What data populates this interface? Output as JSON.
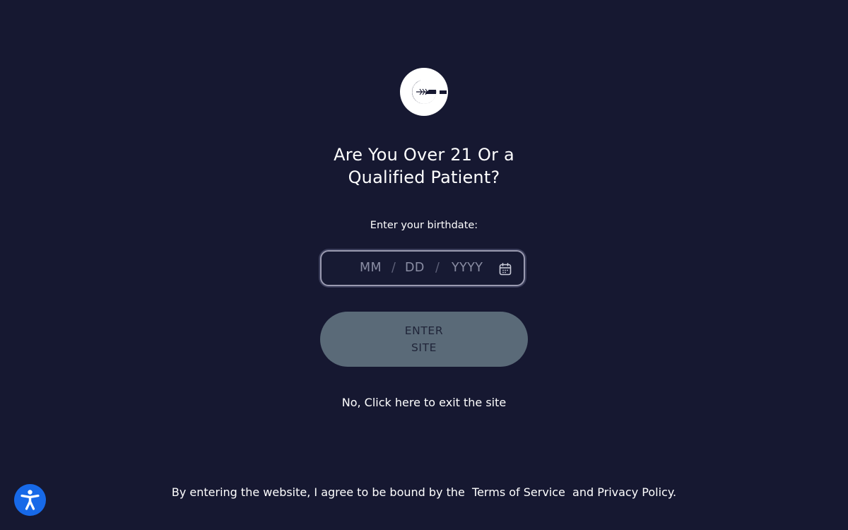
{
  "gate": {
    "title_line1": "Are You Over 21 Or a",
    "title_line2": "Qualified Patient?",
    "prompt": "Enter your birthdate:",
    "date": {
      "month_placeholder": "MM",
      "day_placeholder": "DD",
      "year_placeholder": "YYYY",
      "separator": "/"
    },
    "enter_line1": "ENTER",
    "enter_line2": "SITE",
    "exit_link": "No, Click here to exit the site"
  },
  "footer": {
    "prefix": "By entering the website, I agree to be bound by the",
    "terms_link": "Terms of Service",
    "joiner": "and",
    "privacy_link": "Privacy Policy",
    "suffix": "."
  },
  "icons": {
    "logo": "leaf-circle-logo",
    "calendar": "calendar-icon",
    "accessibility": "accessibility-icon"
  },
  "colors": {
    "background": "#161831",
    "button": "#5a6a78",
    "accessibility": "#1769e8"
  }
}
